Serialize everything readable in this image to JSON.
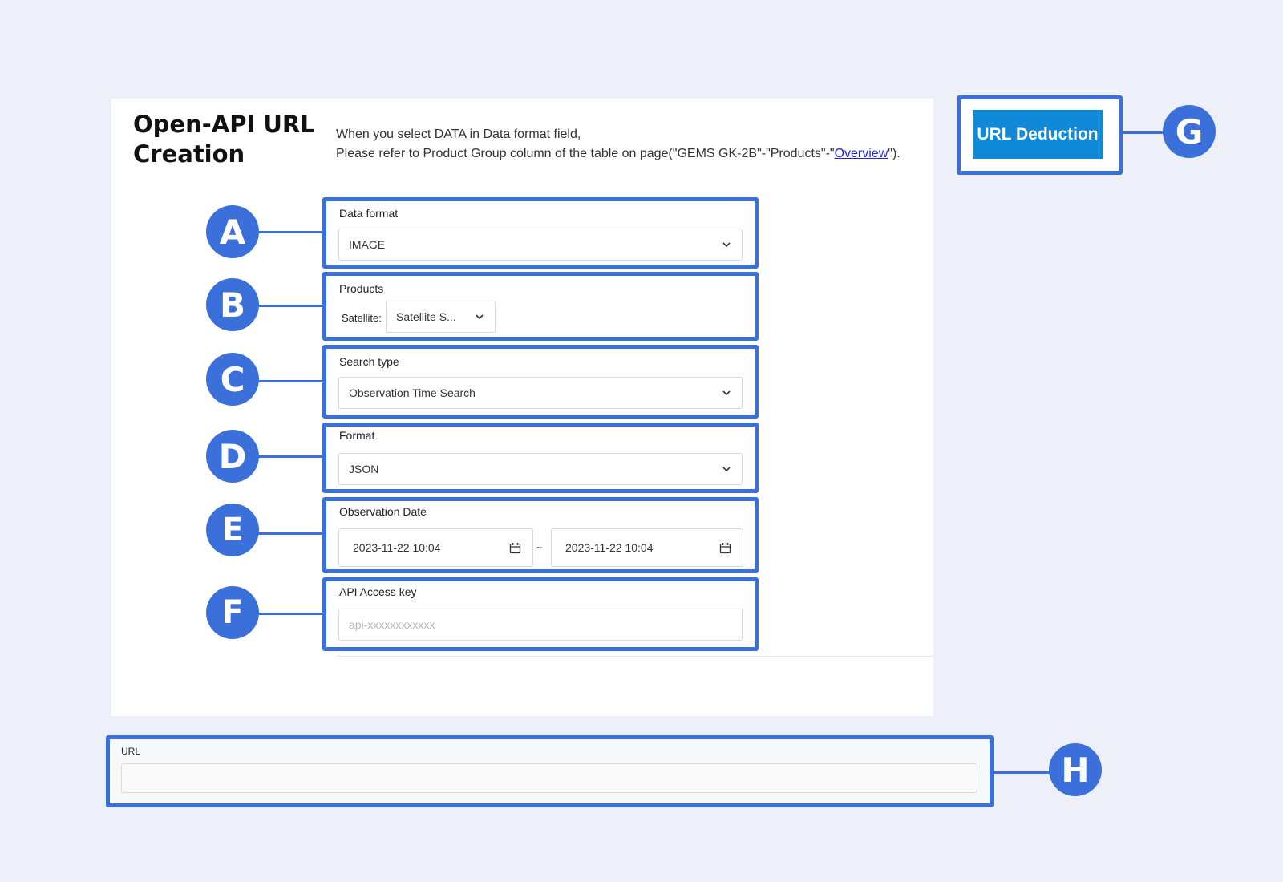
{
  "header": {
    "title": "Open-API URL Creation",
    "notice_line1": "When you select DATA in Data format field,",
    "notice_line2_prefix": "Please refer to Product Group column of the table on page(\"GEMS GK-2B\"-\"Products\"-\"",
    "notice_link": "Overview",
    "notice_line2_suffix": "\")."
  },
  "form": {
    "data_format": {
      "label": "Data format",
      "value": "IMAGE"
    },
    "products": {
      "label": "Products",
      "satellite_label": "Satellite:",
      "satellite_value": "Satellite S..."
    },
    "search_type": {
      "label": "Search type",
      "value": "Observation Time Search"
    },
    "format": {
      "label": "Format",
      "value": "JSON"
    },
    "observation_date": {
      "label": "Observation Date",
      "start": "2023-11-22 10:04",
      "separator": "~",
      "end": "2023-11-22 10:04"
    },
    "api_key": {
      "label": "API Access key",
      "placeholder": "api-xxxxxxxxxxxx"
    }
  },
  "actions": {
    "deduct_label": "URL Deduction"
  },
  "url_output": {
    "label": "URL",
    "value": ""
  },
  "badges": [
    "A",
    "B",
    "C",
    "D",
    "E",
    "F",
    "G",
    "H"
  ],
  "colors": {
    "highlight": "#3b6fd9",
    "button": "#1189d9",
    "background": "#edf0f8"
  },
  "icons": {
    "dropdown": "chevron-down-icon",
    "date": "calendar-icon"
  }
}
